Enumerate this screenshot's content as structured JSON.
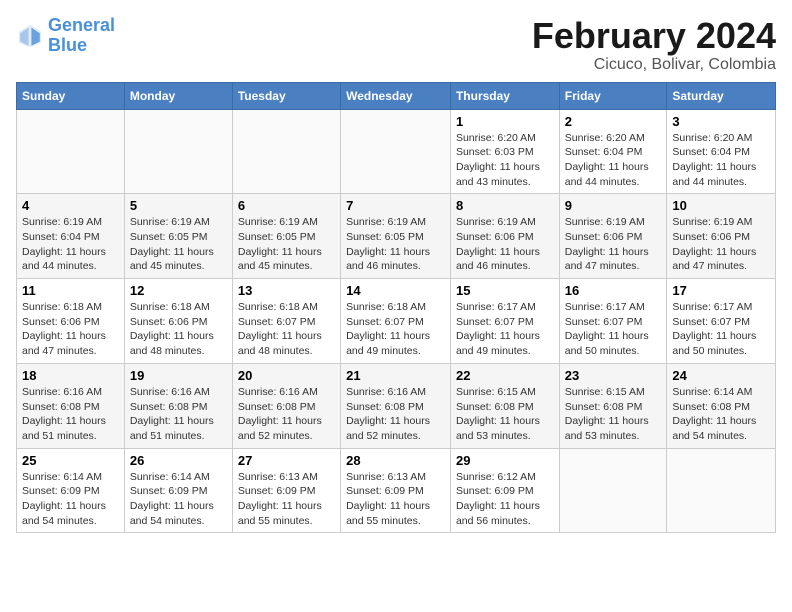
{
  "logo": {
    "line1": "General",
    "line2": "Blue"
  },
  "title": "February 2024",
  "location": "Cicuco, Bolivar, Colombia",
  "days_of_week": [
    "Sunday",
    "Monday",
    "Tuesday",
    "Wednesday",
    "Thursday",
    "Friday",
    "Saturday"
  ],
  "weeks": [
    [
      {
        "num": "",
        "info": ""
      },
      {
        "num": "",
        "info": ""
      },
      {
        "num": "",
        "info": ""
      },
      {
        "num": "",
        "info": ""
      },
      {
        "num": "1",
        "info": "Sunrise: 6:20 AM\nSunset: 6:03 PM\nDaylight: 11 hours\nand 43 minutes."
      },
      {
        "num": "2",
        "info": "Sunrise: 6:20 AM\nSunset: 6:04 PM\nDaylight: 11 hours\nand 44 minutes."
      },
      {
        "num": "3",
        "info": "Sunrise: 6:20 AM\nSunset: 6:04 PM\nDaylight: 11 hours\nand 44 minutes."
      }
    ],
    [
      {
        "num": "4",
        "info": "Sunrise: 6:19 AM\nSunset: 6:04 PM\nDaylight: 11 hours\nand 44 minutes."
      },
      {
        "num": "5",
        "info": "Sunrise: 6:19 AM\nSunset: 6:05 PM\nDaylight: 11 hours\nand 45 minutes."
      },
      {
        "num": "6",
        "info": "Sunrise: 6:19 AM\nSunset: 6:05 PM\nDaylight: 11 hours\nand 45 minutes."
      },
      {
        "num": "7",
        "info": "Sunrise: 6:19 AM\nSunset: 6:05 PM\nDaylight: 11 hours\nand 46 minutes."
      },
      {
        "num": "8",
        "info": "Sunrise: 6:19 AM\nSunset: 6:06 PM\nDaylight: 11 hours\nand 46 minutes."
      },
      {
        "num": "9",
        "info": "Sunrise: 6:19 AM\nSunset: 6:06 PM\nDaylight: 11 hours\nand 47 minutes."
      },
      {
        "num": "10",
        "info": "Sunrise: 6:19 AM\nSunset: 6:06 PM\nDaylight: 11 hours\nand 47 minutes."
      }
    ],
    [
      {
        "num": "11",
        "info": "Sunrise: 6:18 AM\nSunset: 6:06 PM\nDaylight: 11 hours\nand 47 minutes."
      },
      {
        "num": "12",
        "info": "Sunrise: 6:18 AM\nSunset: 6:06 PM\nDaylight: 11 hours\nand 48 minutes."
      },
      {
        "num": "13",
        "info": "Sunrise: 6:18 AM\nSunset: 6:07 PM\nDaylight: 11 hours\nand 48 minutes."
      },
      {
        "num": "14",
        "info": "Sunrise: 6:18 AM\nSunset: 6:07 PM\nDaylight: 11 hours\nand 49 minutes."
      },
      {
        "num": "15",
        "info": "Sunrise: 6:17 AM\nSunset: 6:07 PM\nDaylight: 11 hours\nand 49 minutes."
      },
      {
        "num": "16",
        "info": "Sunrise: 6:17 AM\nSunset: 6:07 PM\nDaylight: 11 hours\nand 50 minutes."
      },
      {
        "num": "17",
        "info": "Sunrise: 6:17 AM\nSunset: 6:07 PM\nDaylight: 11 hours\nand 50 minutes."
      }
    ],
    [
      {
        "num": "18",
        "info": "Sunrise: 6:16 AM\nSunset: 6:08 PM\nDaylight: 11 hours\nand 51 minutes."
      },
      {
        "num": "19",
        "info": "Sunrise: 6:16 AM\nSunset: 6:08 PM\nDaylight: 11 hours\nand 51 minutes."
      },
      {
        "num": "20",
        "info": "Sunrise: 6:16 AM\nSunset: 6:08 PM\nDaylight: 11 hours\nand 52 minutes."
      },
      {
        "num": "21",
        "info": "Sunrise: 6:16 AM\nSunset: 6:08 PM\nDaylight: 11 hours\nand 52 minutes."
      },
      {
        "num": "22",
        "info": "Sunrise: 6:15 AM\nSunset: 6:08 PM\nDaylight: 11 hours\nand 53 minutes."
      },
      {
        "num": "23",
        "info": "Sunrise: 6:15 AM\nSunset: 6:08 PM\nDaylight: 11 hours\nand 53 minutes."
      },
      {
        "num": "24",
        "info": "Sunrise: 6:14 AM\nSunset: 6:08 PM\nDaylight: 11 hours\nand 54 minutes."
      }
    ],
    [
      {
        "num": "25",
        "info": "Sunrise: 6:14 AM\nSunset: 6:09 PM\nDaylight: 11 hours\nand 54 minutes."
      },
      {
        "num": "26",
        "info": "Sunrise: 6:14 AM\nSunset: 6:09 PM\nDaylight: 11 hours\nand 54 minutes."
      },
      {
        "num": "27",
        "info": "Sunrise: 6:13 AM\nSunset: 6:09 PM\nDaylight: 11 hours\nand 55 minutes."
      },
      {
        "num": "28",
        "info": "Sunrise: 6:13 AM\nSunset: 6:09 PM\nDaylight: 11 hours\nand 55 minutes."
      },
      {
        "num": "29",
        "info": "Sunrise: 6:12 AM\nSunset: 6:09 PM\nDaylight: 11 hours\nand 56 minutes."
      },
      {
        "num": "",
        "info": ""
      },
      {
        "num": "",
        "info": ""
      }
    ]
  ]
}
